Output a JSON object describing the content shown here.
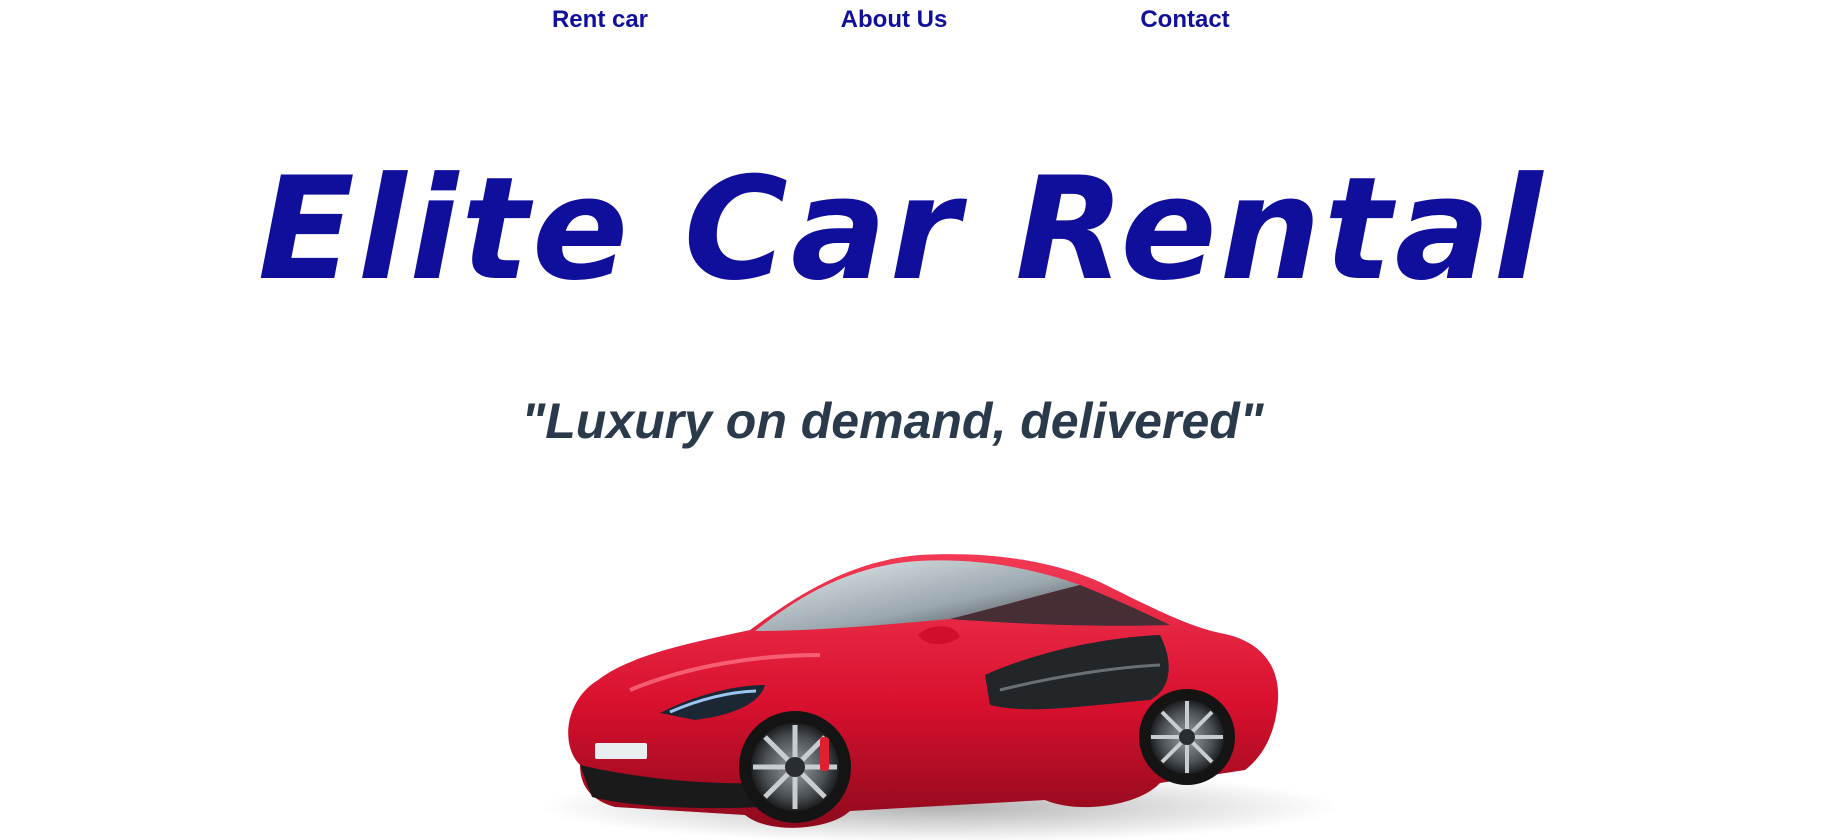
{
  "nav": {
    "items": [
      {
        "label": "Rent car"
      },
      {
        "label": "About Us"
      },
      {
        "label": "Contact"
      }
    ]
  },
  "hero": {
    "title": "Elite Car Rental",
    "tagline": "\"Luxury on demand, delivered\""
  },
  "colors": {
    "brand_blue": "#10109c",
    "tagline_slate": "#2b3a4a",
    "car_red": "#d8102e"
  },
  "images": {
    "hero_car": "red-sports-car"
  }
}
